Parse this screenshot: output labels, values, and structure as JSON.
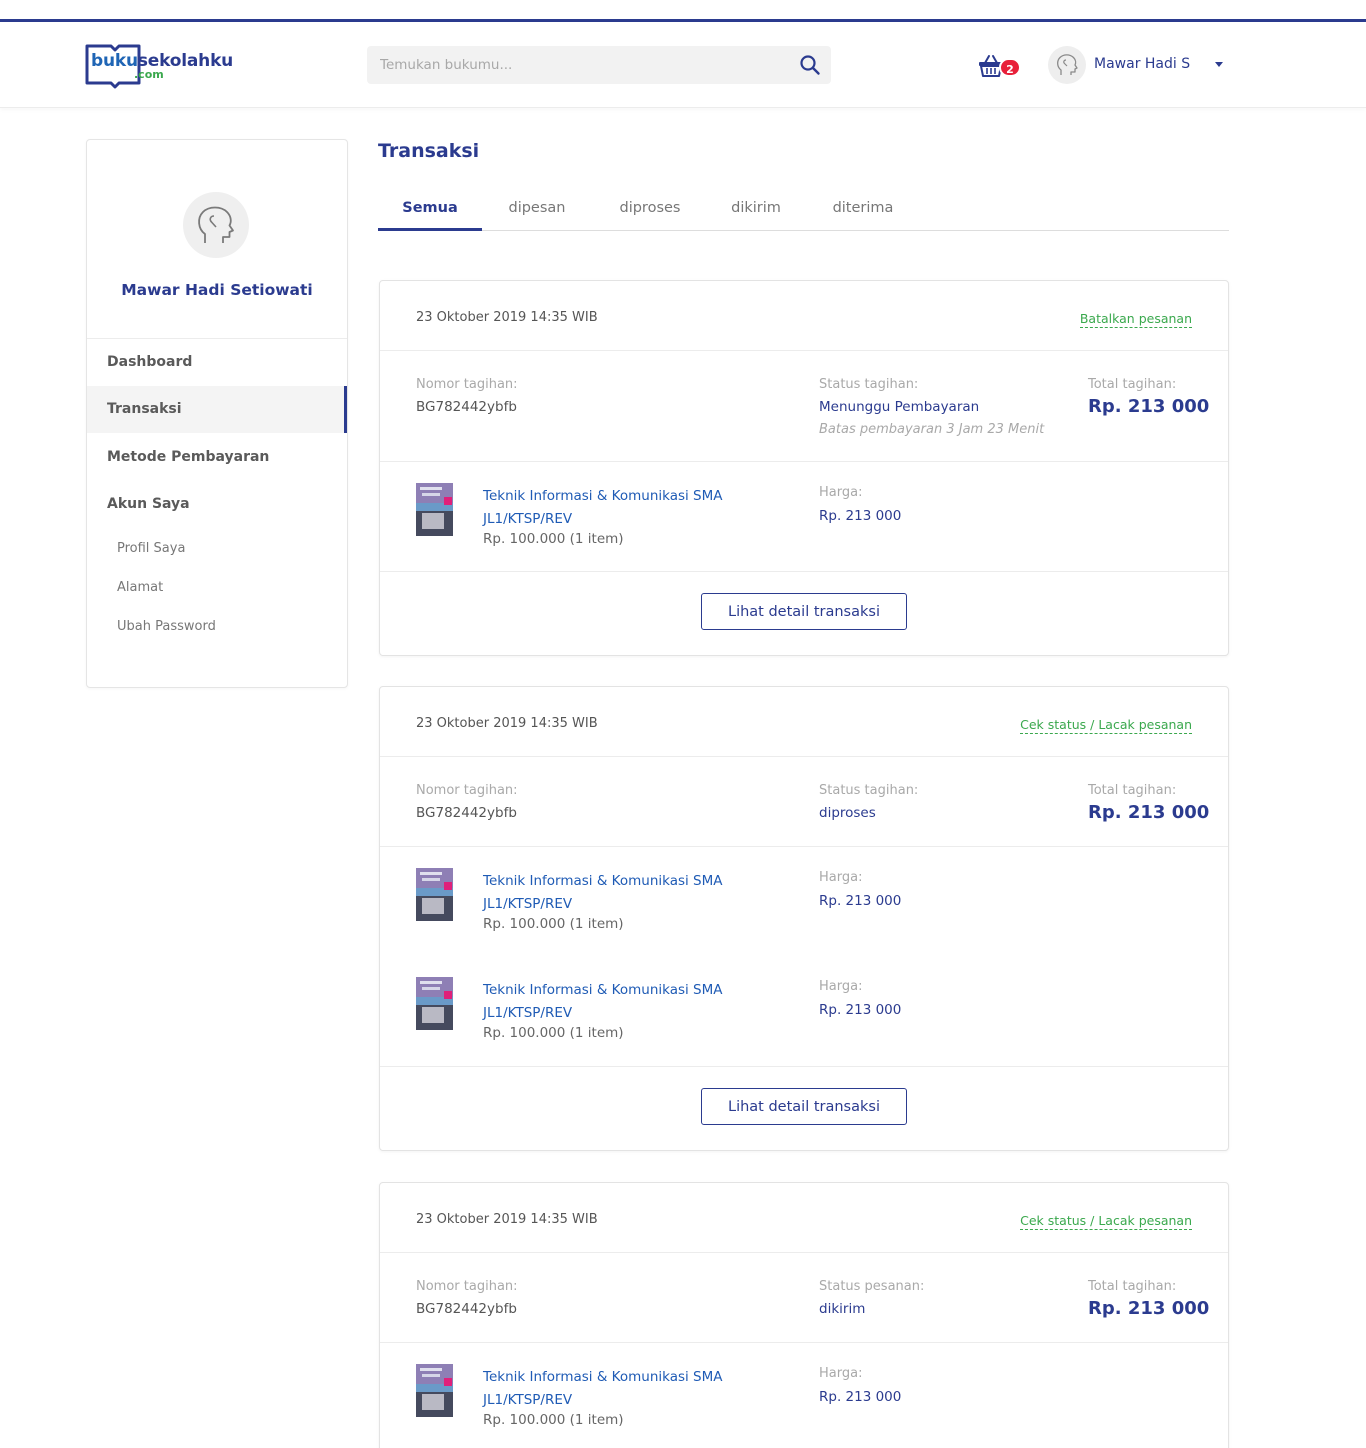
{
  "header": {
    "logo": {
      "part1": "buku",
      "part2": "sekolahku",
      "part3": ".com"
    },
    "search_placeholder": "Temukan bukumu...",
    "cart_count": "2",
    "user_name": "Mawar Hadi S"
  },
  "sidebar": {
    "profile_name": "Mawar Hadi Setiowati",
    "nav": {
      "dashboard": "Dashboard",
      "transaksi": "Transaksi",
      "metode": "Metode Pembayaran",
      "akun": "Akun Saya"
    },
    "sub": {
      "profil": "Profil Saya",
      "alamat": "Alamat",
      "password": "Ubah Password"
    }
  },
  "main": {
    "title": "Transaksi",
    "tabs": [
      "Semua",
      "dipesan",
      "diproses",
      "dikirim",
      "diterima"
    ],
    "active_tab": "Semua"
  },
  "transactions": [
    {
      "date": "23 Oktober 2019 14:35 WIB",
      "action": "Batalkan pesanan",
      "invoice_label": "Nomor tagihan:",
      "invoice": "BG782442ybfb",
      "status_label": "Status tagihan:",
      "status": "Menunggu Pembayaran",
      "deadline": "Batas pembayaran 3 Jam 23 Menit",
      "total_label": "Total tagihan:",
      "total": "Rp. 213 000",
      "items": [
        {
          "title_line1": "Teknik Informasi & Komunikasi SMA",
          "title_line2": "JL1/KTSP/REV",
          "price": "Rp. 100.000 (1 item)",
          "harga_label": "Harga:",
          "harga": "Rp. 213 000"
        }
      ],
      "button": "Lihat detail transaksi"
    },
    {
      "date": "23 Oktober 2019 14:35 WIB",
      "action": "Cek status / Lacak pesanan",
      "invoice_label": "Nomor tagihan:",
      "invoice": "BG782442ybfb",
      "status_label": "Status tagihan:",
      "status": "diproses",
      "total_label": "Total tagihan:",
      "total": "Rp. 213 000",
      "items": [
        {
          "title_line1": "Teknik Informasi & Komunikasi SMA",
          "title_line2": "JL1/KTSP/REV",
          "price": "Rp. 100.000 (1 item)",
          "harga_label": "Harga:",
          "harga": "Rp. 213 000"
        },
        {
          "title_line1": "Teknik Informasi & Komunikasi SMA",
          "title_line2": "JL1/KTSP/REV",
          "price": "Rp. 100.000 (1 item)",
          "harga_label": "Harga:",
          "harga": "Rp. 213 000"
        }
      ],
      "button": "Lihat detail transaksi"
    },
    {
      "date": "23 Oktober 2019 14:35 WIB",
      "action": "Cek status / Lacak pesanan",
      "invoice_label": "Nomor tagihan:",
      "invoice": "BG782442ybfb",
      "status_label": "Status pesanan:",
      "status": "dikirim",
      "total_label": "Total tagihan:",
      "total": "Rp. 213 000",
      "items": [
        {
          "title_line1": "Teknik Informasi & Komunikasi SMA",
          "title_line2": "JL1/KTSP/REV",
          "price": "Rp. 100.000 (1 item)",
          "harga_label": "Harga:",
          "harga": "Rp. 213 000"
        }
      ]
    }
  ],
  "colors": {
    "primary": "#2b3b8f",
    "link": "#1f5bb5",
    "accent_green": "#3aa84d",
    "badge": "#e8203a"
  }
}
